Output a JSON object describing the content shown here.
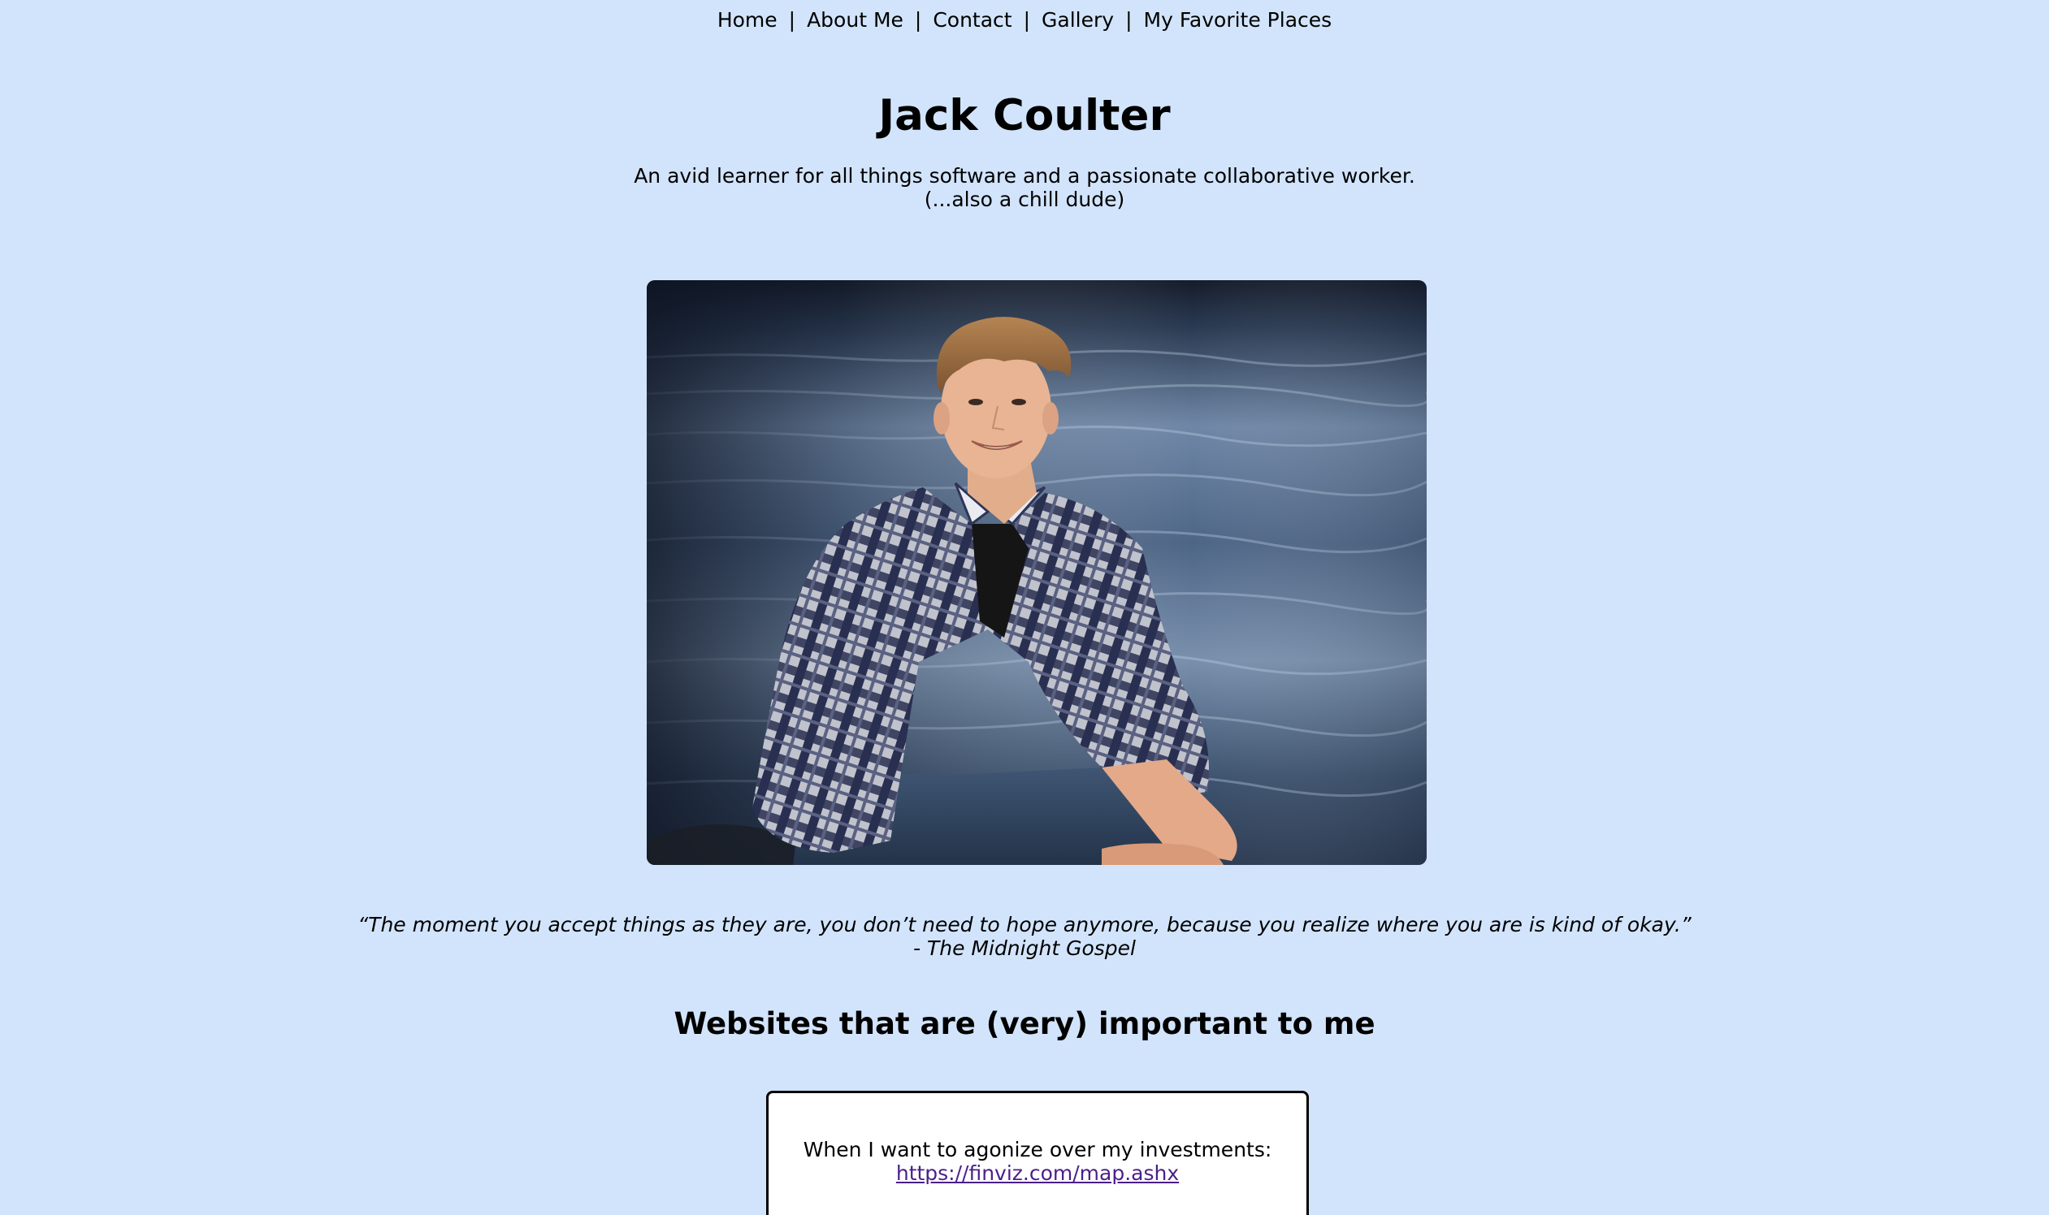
{
  "nav": {
    "items": [
      {
        "label": "Home"
      },
      {
        "label": "About Me"
      },
      {
        "label": "Contact"
      },
      {
        "label": "Gallery"
      },
      {
        "label": "My Favorite Places"
      }
    ],
    "separator": "|"
  },
  "header": {
    "title": "Jack Coulter",
    "tagline_line1": "An avid learner for all things software and a passionate collaborative worker.",
    "tagline_line2": "(...also a chill dude)"
  },
  "photo": {
    "subject": "portrait-photo"
  },
  "quote": {
    "text": "“The moment you accept things as they are, you don’t need to hope anymore, because you realize where you are is kind of okay.”",
    "attribution": "- The Midnight Gospel"
  },
  "websites": {
    "heading": "Websites that are (very) important to me",
    "items": [
      {
        "caption": "When I want to agonize over my investments:",
        "url": "https://finviz.com/map.ashx"
      }
    ]
  },
  "colors": {
    "background": "#d2e4fb",
    "text": "#000000",
    "link_visited": "#4b1f8a",
    "card_background": "#ffffff"
  }
}
